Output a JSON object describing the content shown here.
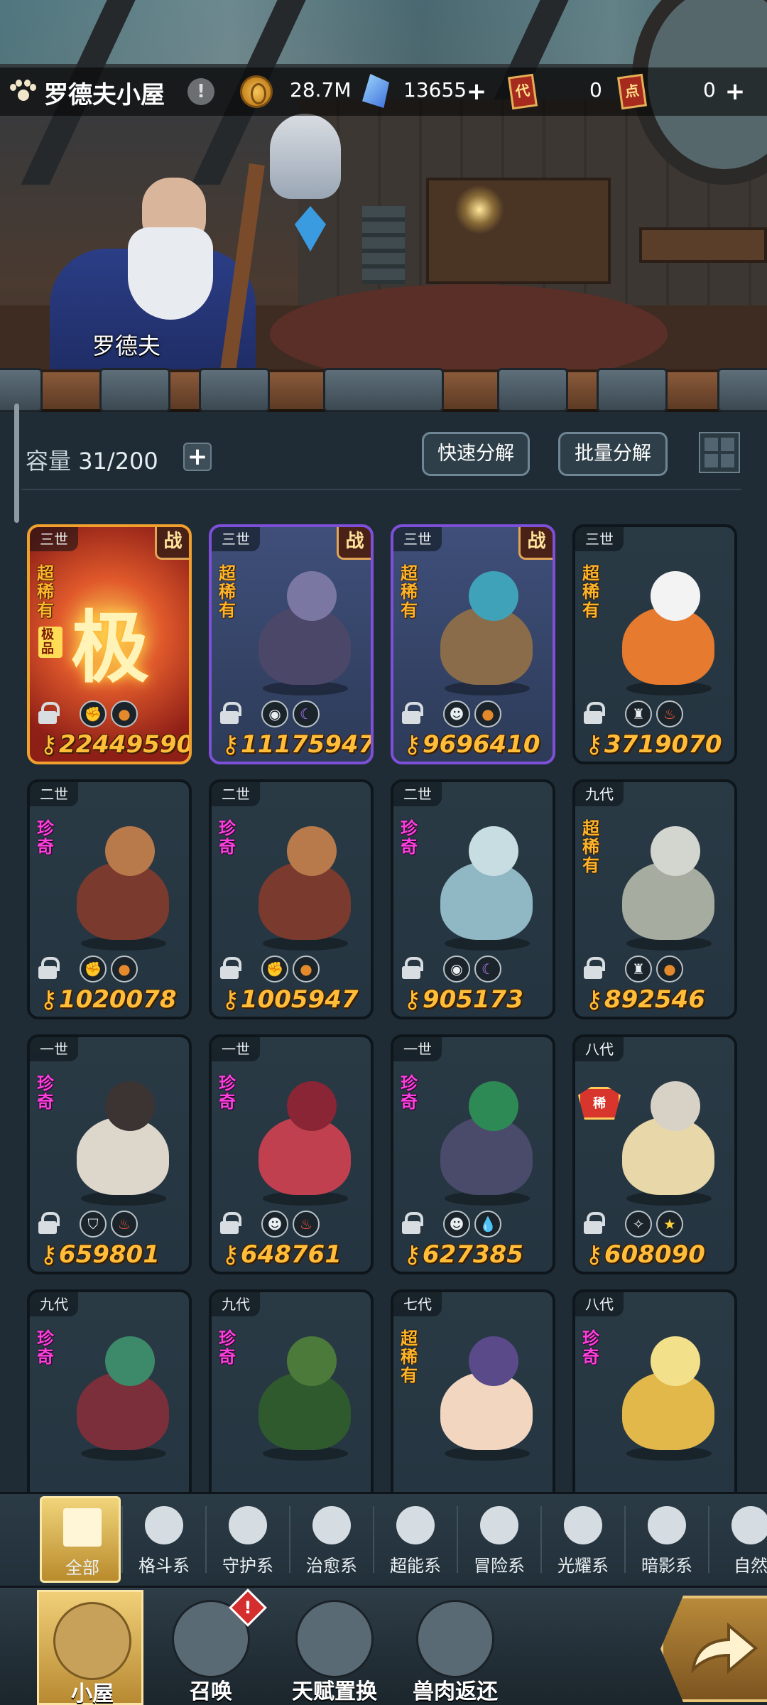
{
  "header": {
    "title": "罗德夫小屋",
    "help_symbol": "!",
    "coins": "28.7M",
    "crystals": "13655",
    "ticket_a_label": "代",
    "ticket_a_count": "0",
    "ticket_b_label": "点",
    "ticket_b_count": "0",
    "plus": "+"
  },
  "npc_name": "罗德夫",
  "storage": {
    "capacity_label": "容量",
    "capacity_value": "31/200",
    "add": "+",
    "quick_decompose": "快速分解",
    "batch_decompose": "批量分解"
  },
  "cards": [
    {
      "gen": "三世",
      "battle": "战",
      "rarity": "超稀有",
      "extra": "极品",
      "power": "22449590",
      "style": "gold",
      "icons": [
        "fist-icon",
        "boot-icon"
      ],
      "glyph": "极"
    },
    {
      "gen": "三世",
      "battle": "战",
      "rarity": "超稀有",
      "power": "11175947",
      "style": "purple",
      "icons": [
        "eye-icon",
        "moon-icon"
      ]
    },
    {
      "gen": "三世",
      "battle": "战",
      "rarity": "超稀有",
      "power": "9696410",
      "style": "purple",
      "icons": [
        "alien-icon",
        "boot-icon"
      ]
    },
    {
      "gen": "三世",
      "rarity": "超稀有",
      "power": "3719070",
      "style": "plain",
      "icons": [
        "lantern-icon",
        "fire-icon"
      ]
    },
    {
      "gen": "二世",
      "rarity": "珍奇",
      "power": "1020078",
      "style": "plain",
      "icons": [
        "fist-icon",
        "boot-icon"
      ]
    },
    {
      "gen": "二世",
      "rarity": "珍奇",
      "power": "1005947",
      "style": "plain",
      "icons": [
        "fist-icon",
        "boot-icon"
      ]
    },
    {
      "gen": "二世",
      "rarity": "珍奇",
      "power": "905173",
      "style": "plain",
      "icons": [
        "eye-icon",
        "moon-icon"
      ]
    },
    {
      "gen": "九代",
      "rarity": "超稀有",
      "power": "892546",
      "style": "plain",
      "icons": [
        "lantern-icon",
        "boot-icon"
      ]
    },
    {
      "gen": "一世",
      "rarity": "珍奇",
      "power": "659801",
      "style": "plain",
      "icons": [
        "shield-icon",
        "fire-icon"
      ]
    },
    {
      "gen": "一世",
      "rarity": "珍奇",
      "power": "648761",
      "style": "plain",
      "icons": [
        "alien-icon",
        "fire-icon"
      ]
    },
    {
      "gen": "一世",
      "rarity": "珍奇",
      "power": "627385",
      "style": "plain",
      "icons": [
        "alien-icon",
        "water-icon"
      ]
    },
    {
      "gen": "八代",
      "rarity": "",
      "badge": "稀",
      "power": "608090",
      "style": "plain",
      "icons": [
        "star-cross-icon",
        "star-icon"
      ]
    },
    {
      "gen": "九代",
      "rarity": "珍奇",
      "power": "",
      "style": "plain",
      "icons": []
    },
    {
      "gen": "九代",
      "rarity": "珍奇",
      "power": "",
      "style": "plain",
      "icons": []
    },
    {
      "gen": "七代",
      "rarity": "超稀有",
      "power": "",
      "style": "plain",
      "icons": []
    },
    {
      "gen": "八代",
      "rarity": "珍奇",
      "power": "",
      "style": "plain",
      "icons": []
    }
  ],
  "filters": [
    {
      "label": "全部",
      "icon": "all-icon"
    },
    {
      "label": "格斗系",
      "icon": "fist-icon"
    },
    {
      "label": "守护系",
      "icon": "shield-icon"
    },
    {
      "label": "治愈系",
      "icon": "sprout-icon"
    },
    {
      "label": "超能系",
      "icon": "alien-icon"
    },
    {
      "label": "冒险系",
      "icon": "lantern-icon"
    },
    {
      "label": "光耀系",
      "icon": "star-cross-icon"
    },
    {
      "label": "暗影系",
      "icon": "eye-icon"
    },
    {
      "label": "自然",
      "icon": "leaf-icon"
    }
  ],
  "nav": [
    {
      "label": "小屋",
      "icon": "house-icon"
    },
    {
      "label": "召唤",
      "icon": "egg-icon"
    },
    {
      "label": "天赋置换",
      "icon": "swap-icon"
    },
    {
      "label": "兽肉返还",
      "icon": "meat-icon"
    }
  ],
  "summon_alert": "!"
}
